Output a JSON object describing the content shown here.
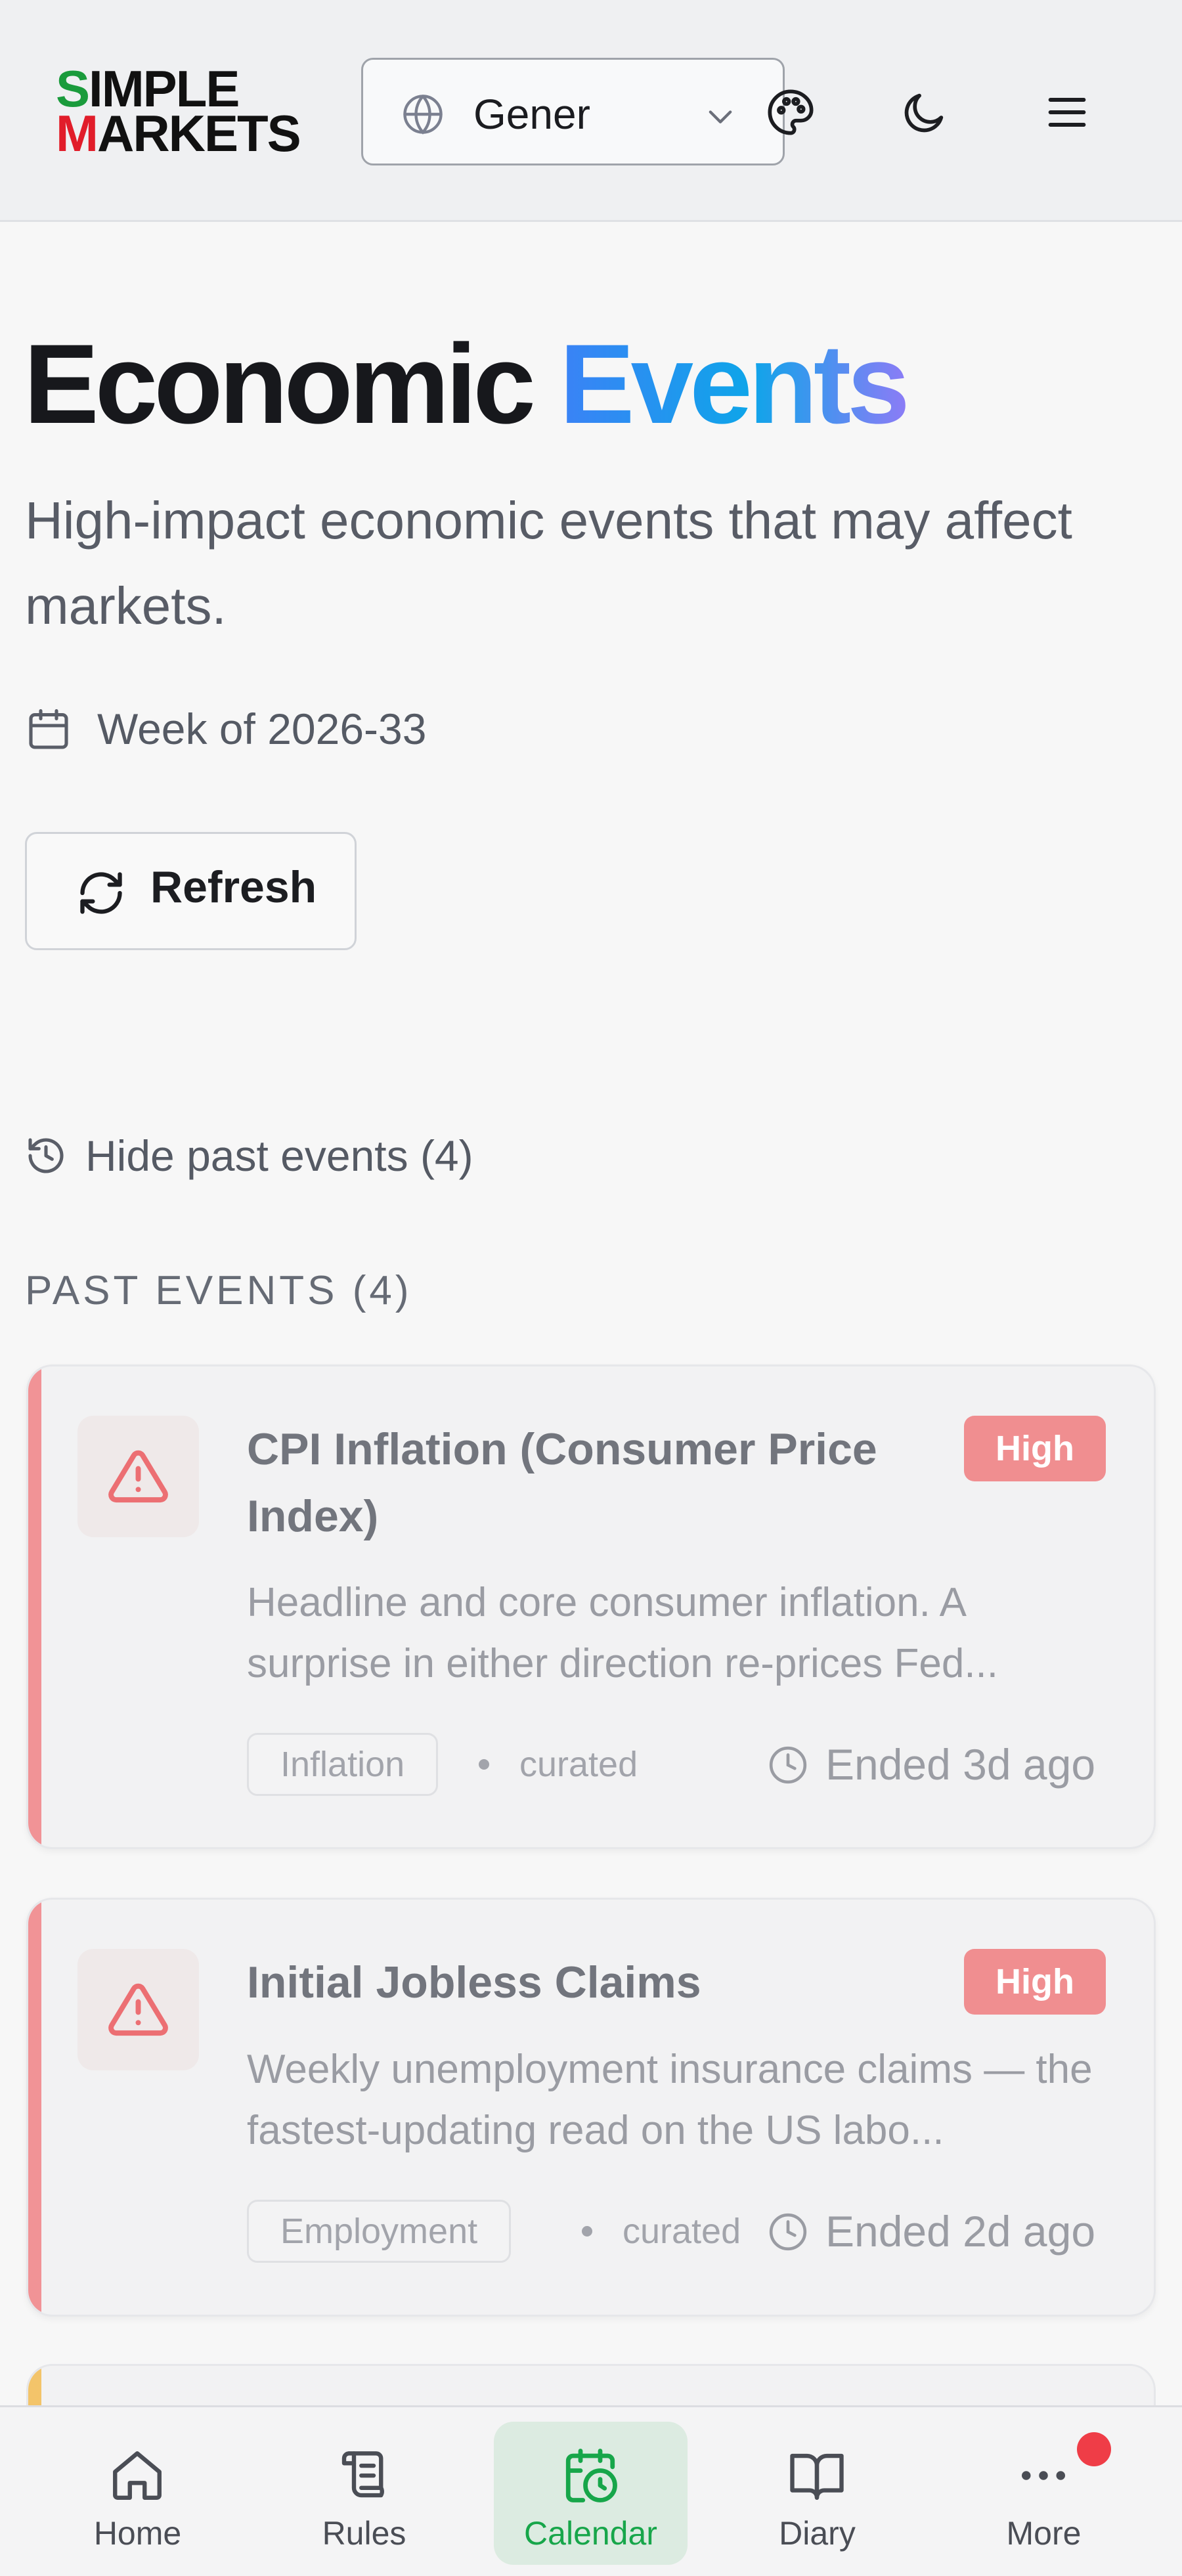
{
  "header": {
    "logo": {
      "line1_first": "S",
      "line1_rest": "IMPLE",
      "line2_first": "M",
      "line2_rest": "ARKETS"
    },
    "language_select": {
      "value": "Gener",
      "icon": "globe-icon"
    },
    "icons": [
      "palette-icon",
      "moon-icon",
      "menu-icon"
    ]
  },
  "page": {
    "title_main": "Economic",
    "title_accent": "Events",
    "subtitle": "High-impact economic events that may affect markets.",
    "week_label": "Week of 2026-33",
    "refresh_label": "Refresh",
    "toggle_past_label": "Hide past events (4)",
    "section_label": "PAST EVENTS (4)"
  },
  "events": [
    {
      "title": "CPI Inflation (Consumer Price Index)",
      "impact": "High",
      "description": "Headline and core consumer inflation. A surprise in either direction re-prices Fed...",
      "category": "Inflation",
      "source": "curated",
      "status": "Ended 3d ago"
    },
    {
      "title": "Initial Jobless Claims",
      "impact": "High",
      "description": "Weekly unemployment insurance claims — the fastest-updating read on the US labo...",
      "category": "Employment",
      "source": "curated",
      "status": "Ended 2d ago"
    }
  ],
  "bottom_nav": {
    "items": [
      {
        "label": "Home",
        "icon": "home-icon"
      },
      {
        "label": "Rules",
        "icon": "scroll-icon"
      },
      {
        "label": "Calendar",
        "icon": "calendar-clock-icon",
        "active": true
      },
      {
        "label": "Diary",
        "icon": "book-icon"
      },
      {
        "label": "More",
        "icon": "more-icon",
        "notification": true
      }
    ]
  },
  "colors": {
    "accent_blue": "#3b82f6",
    "high_impact": "#f08e90",
    "nav_active": "#17a64a",
    "notification": "#ef3d47"
  }
}
